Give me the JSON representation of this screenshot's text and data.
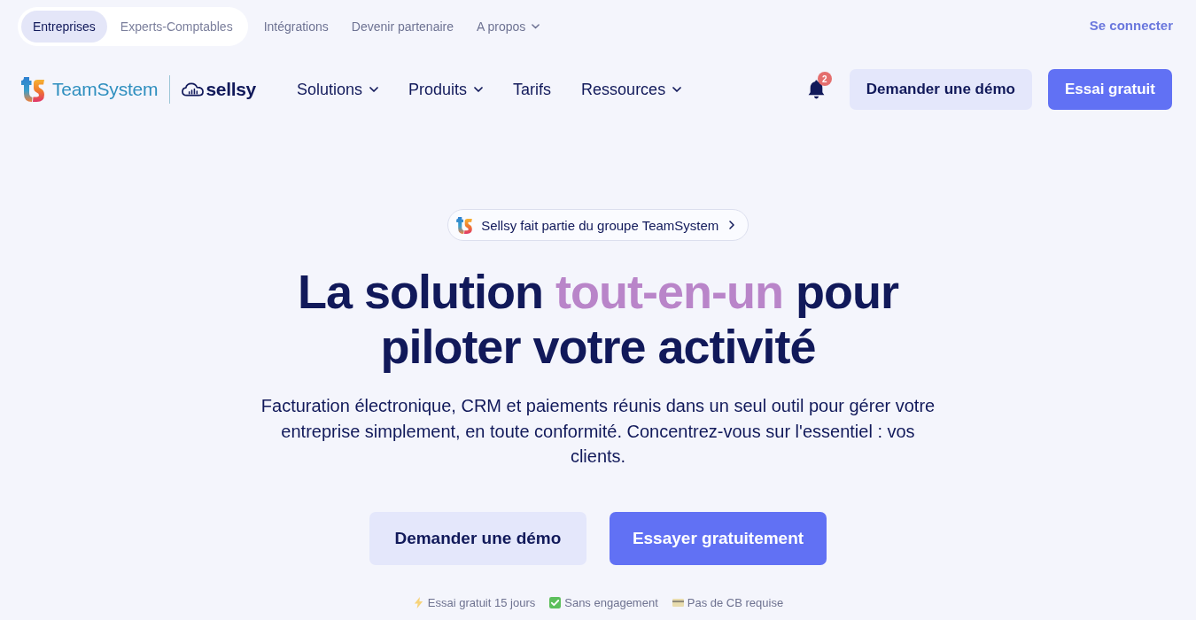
{
  "top_bar": {
    "audience_tabs": [
      {
        "label": "Entreprises",
        "selected": true
      },
      {
        "label": "Experts-Comptables",
        "selected": false
      }
    ],
    "links": [
      {
        "label": "Intégrations",
        "dropdown": false
      },
      {
        "label": "Devenir partenaire",
        "dropdown": false
      },
      {
        "label": "A propos",
        "dropdown": true
      }
    ],
    "login_link": "Se connecter"
  },
  "header": {
    "logos": {
      "partner": "TeamSystem",
      "brand": "sellsy"
    },
    "nav": [
      {
        "label": "Solutions",
        "dropdown": true
      },
      {
        "label": "Produits",
        "dropdown": true
      },
      {
        "label": "Tarifs",
        "dropdown": false
      },
      {
        "label": "Ressources",
        "dropdown": true
      }
    ],
    "notifications": {
      "count": "2"
    },
    "buttons": [
      {
        "label": "Demander une démo",
        "kind": "secondary"
      },
      {
        "label": "Essai gratuit",
        "kind": "primary"
      }
    ]
  },
  "hero": {
    "announcement": "Sellsy fait partie du groupe TeamSystem",
    "heading": {
      "before": "La solution ",
      "highlight": "tout-en-un",
      "after": " pour piloter votre activité"
    },
    "subtitle": "Facturation électronique, CRM et paiements réunis dans un seul outil pour gérer votre entreprise simplement, en toute conformité. Concentrez-vous sur l'essentiel : vos clients.",
    "buttons": [
      {
        "label": "Demander une démo",
        "kind": "secondary"
      },
      {
        "label": "Essayer gratuitement",
        "kind": "primary"
      }
    ],
    "perks": [
      {
        "kind": "lightning",
        "text": "Essai gratuit 15 jours"
      },
      {
        "kind": "check",
        "text": "Sans engagement"
      },
      {
        "kind": "card",
        "text": "Pas de CB requise"
      }
    ]
  }
}
